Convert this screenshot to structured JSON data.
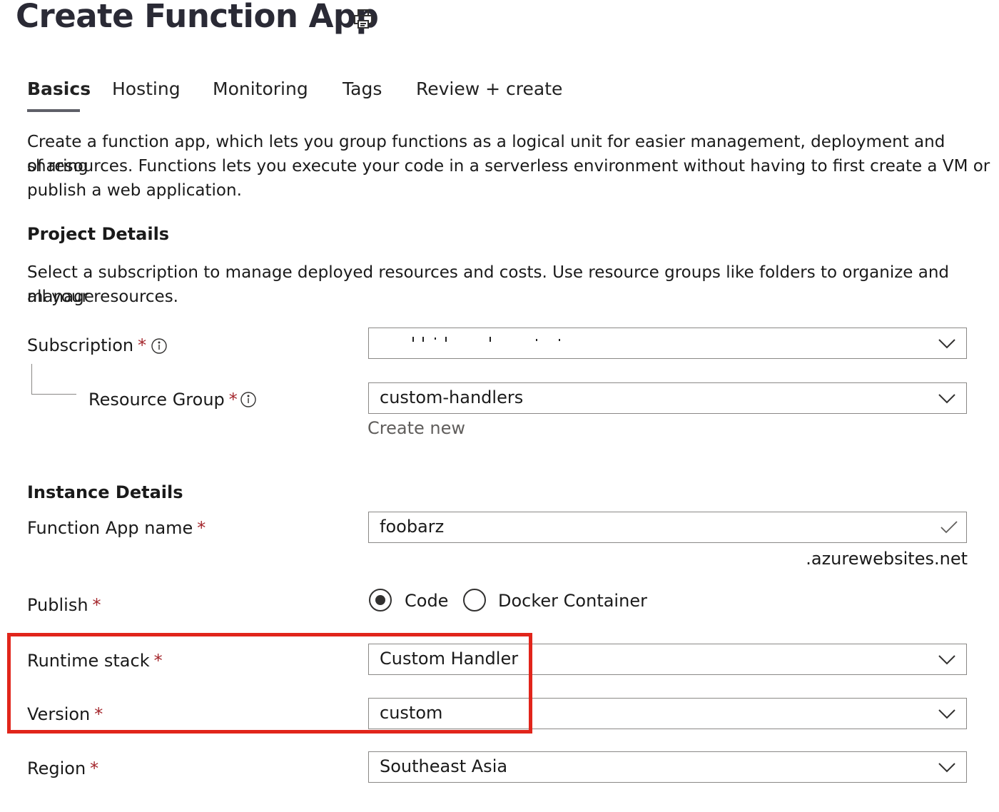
{
  "header": {
    "title": "Create Function App",
    "print_icon": "print-icon"
  },
  "tabs": [
    {
      "label": "Basics",
      "active": true
    },
    {
      "label": "Hosting",
      "active": false
    },
    {
      "label": "Monitoring",
      "active": false
    },
    {
      "label": "Tags",
      "active": false
    },
    {
      "label": "Review + create",
      "active": false
    }
  ],
  "intro": {
    "line1": "Create a function app, which lets you group functions as a logical unit for easier management, deployment and sharing",
    "line2": "of resources. Functions lets you execute your code in a serverless environment without having to first create a VM or",
    "line3": "publish a web application."
  },
  "project": {
    "heading": "Project Details",
    "desc_line1": "Select a subscription to manage deployed resources and costs. Use resource groups like folders to organize and manage",
    "desc_line2": "all your resources.",
    "subscription": {
      "label": "Subscription",
      "value": ""
    },
    "resource_group": {
      "label": "Resource Group",
      "value": "custom-handlers",
      "create_new": "Create new"
    }
  },
  "instance": {
    "heading": "Instance Details",
    "app_name": {
      "label": "Function App name",
      "value": "foobarz",
      "suffix": ".azurewebsites.net"
    },
    "publish": {
      "label": "Publish",
      "options": [
        "Code",
        "Docker Container"
      ],
      "selected": "Code"
    },
    "runtime_stack": {
      "label": "Runtime stack",
      "value": "Custom Handler"
    },
    "version": {
      "label": "Version",
      "value": "custom"
    },
    "region": {
      "label": "Region",
      "value": "Southeast Asia"
    }
  },
  "required_marker": "*",
  "colors": {
    "highlight": "#e1251b",
    "required": "#a4262c",
    "border": "#8a8886",
    "link": "#605e5c"
  }
}
